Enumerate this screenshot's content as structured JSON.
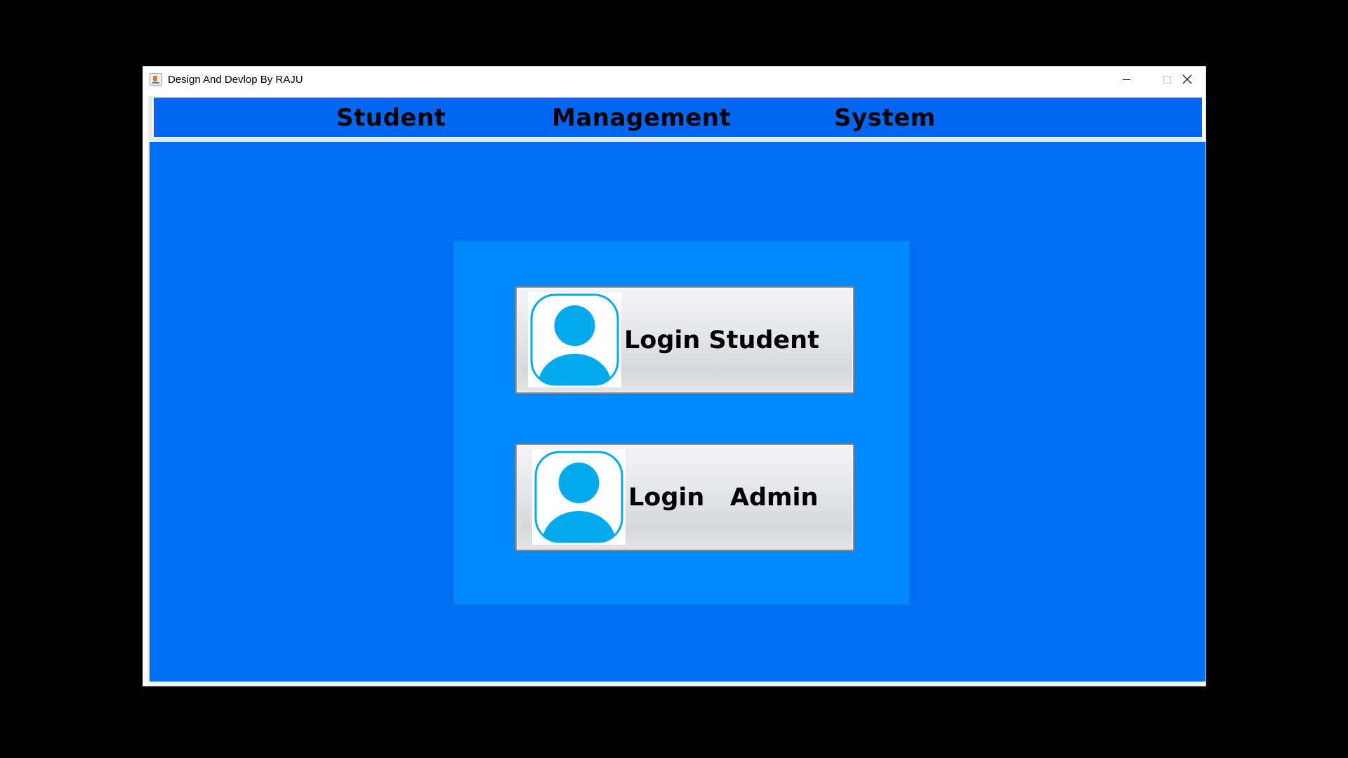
{
  "window": {
    "title": "Design And Devlop By RAJU",
    "icon": "java-app-icon"
  },
  "menu": {
    "items": [
      {
        "label": "Student"
      },
      {
        "label": "Management"
      },
      {
        "label": "System"
      }
    ]
  },
  "login": {
    "student_label": "Login Student",
    "admin_label": "Login   Admin",
    "icon": "user-avatar-icon"
  },
  "colors": {
    "menu_bar": "#0066f0",
    "background": "#006ff2",
    "login_panel": "#0088ff",
    "avatar": "#00aaeb"
  }
}
